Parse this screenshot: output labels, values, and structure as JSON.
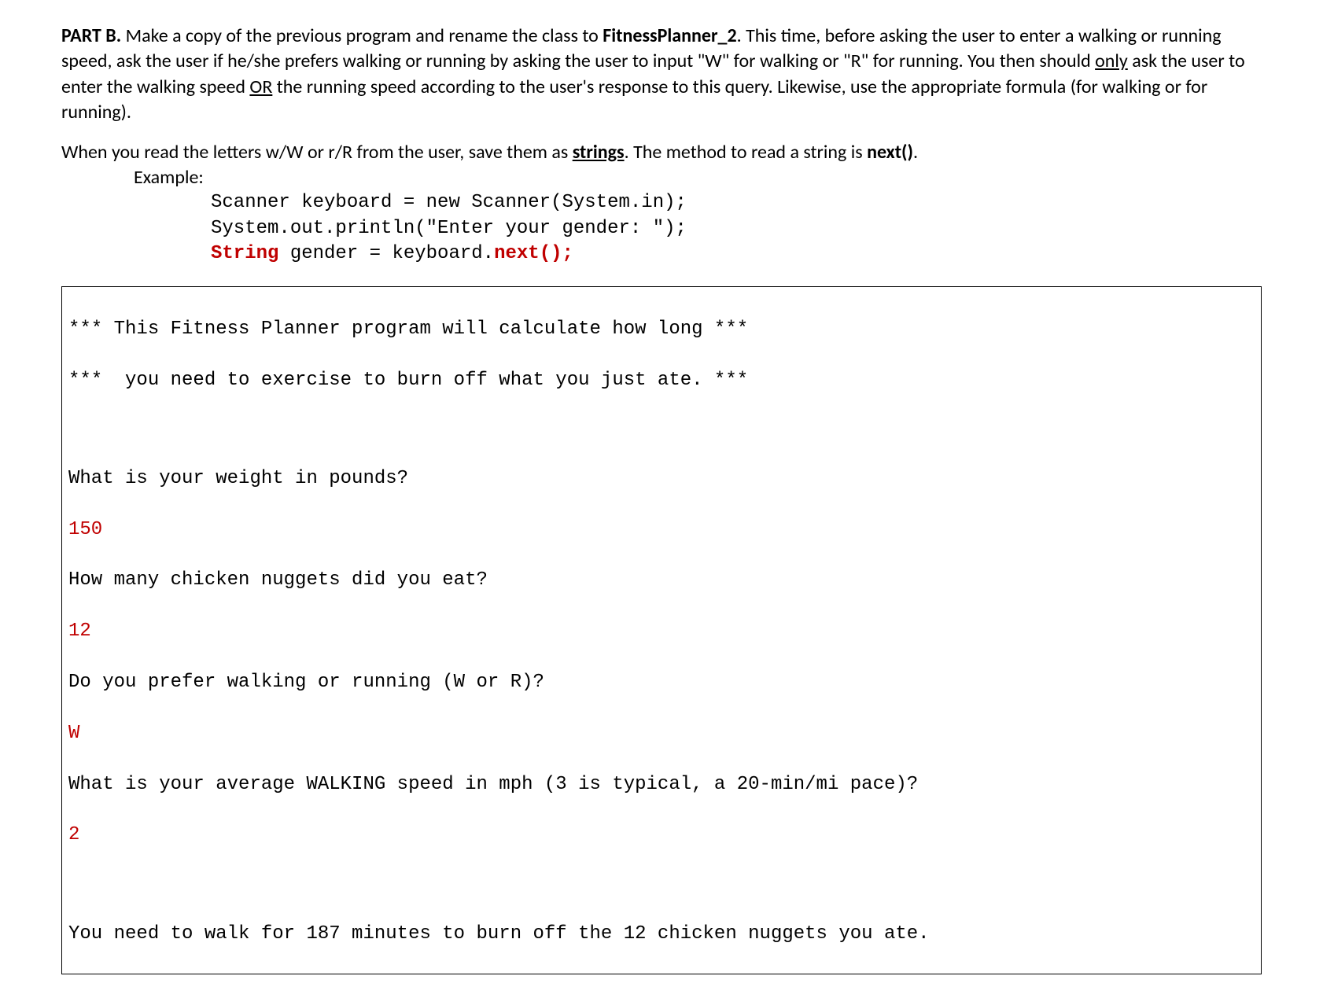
{
  "para1": {
    "partLabel": "PART B. ",
    "text1": "Make a copy of the previous program and rename the class to ",
    "className": "FitnessPlanner_2",
    "text2": ". This time, before asking the user to enter a walking or running speed, ask the user if he/she prefers walking or running by asking the user to input \"W\" for walking or \"R\" for running. You then should ",
    "only": "only",
    "text3": " ask the user to enter the walking speed ",
    "or": "OR",
    "text4": " the running speed according to the user's response to this query. Likewise, use the appropriate formula (for walking or for running)."
  },
  "para2": {
    "text1": "When you read the letters w/W or r/R from the user, save them as ",
    "strings": "strings",
    "text2": ". The method to read a string is ",
    "next": "next()",
    "text3": "."
  },
  "exampleLabel": "Example:",
  "code": {
    "line1": "Scanner keyboard = new Scanner(System.in);",
    "line2": "System.out.println(\"Enter your gender: \");",
    "line3a": "String",
    "line3b": " gender = keyboard.",
    "line3c": "next();"
  },
  "output": {
    "line1": "*** This Fitness Planner program will calculate how long ***",
    "line2": "***  you need to exercise to burn off what you just ate. ***",
    "line3": "What is your weight in pounds?",
    "input1": "150",
    "line4": "How many chicken nuggets did you eat?",
    "input2": "12",
    "line5": "Do you prefer walking or running (W or R)?",
    "input3": "W",
    "line6": "What is your average WALKING speed in mph (3 is typical, a 20-min/mi pace)?",
    "input4": "2",
    "line7": "You need to walk for 187 minutes to burn off the 12 chicken nuggets you ate."
  }
}
